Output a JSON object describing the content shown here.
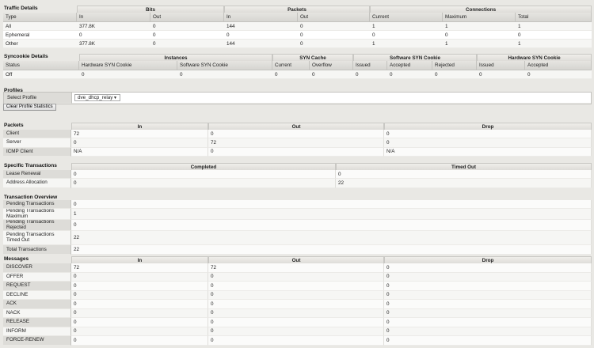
{
  "traffic": {
    "title": "Traffic Details",
    "groups": [
      "Bits",
      "Packets",
      "Connections"
    ],
    "columns": [
      "Type",
      "In",
      "Out",
      "In",
      "Out",
      "Current",
      "Maximum",
      "Total"
    ],
    "rows": [
      [
        "All",
        "377.8K",
        "0",
        "144",
        "0",
        "1",
        "1",
        "1"
      ],
      [
        "Ephemeral",
        "0",
        "0",
        "0",
        "0",
        "0",
        "0",
        "0"
      ],
      [
        "Other",
        "377.8K",
        "0",
        "144",
        "0",
        "1",
        "1",
        "1"
      ]
    ]
  },
  "syncookie": {
    "title": "Syncookie Details",
    "groups": [
      "Instances",
      "SYN Cache",
      "Software SYN Cookie",
      "Hardware SYN Cookie"
    ],
    "columns": [
      "Status",
      "Hardware SYN Cookie",
      "Software SYN Cookie",
      "Current",
      "Overflow",
      "Issued",
      "Accepted",
      "Rejected",
      "Issued",
      "Accepted"
    ],
    "rows": [
      [
        "Off",
        "0",
        "0",
        "0",
        "0",
        "0",
        "0",
        "0",
        "0",
        "0"
      ]
    ]
  },
  "profiles": {
    "title": "Profiles",
    "select_label": "Select Profile",
    "selected": "dve_dhcp_relay",
    "clear_button": "Clear Profile Statistics"
  },
  "packets": {
    "title": "Packets",
    "columns": [
      "In",
      "Out",
      "Drop"
    ],
    "rows": [
      [
        "Client",
        "72",
        "0",
        "0"
      ],
      [
        "Server",
        "0",
        "72",
        "0"
      ],
      [
        "ICMP Client",
        "N/A",
        "0",
        "N/A"
      ]
    ]
  },
  "specific": {
    "title": "Specific Transactions",
    "columns": [
      "Completed",
      "Timed Out"
    ],
    "rows": [
      [
        "Lease Renewal",
        "0",
        "0"
      ],
      [
        "Address Allocation",
        "0",
        "22"
      ]
    ]
  },
  "overview": {
    "title": "Transaction Overview",
    "rows": [
      [
        "Pending Transactions",
        "0"
      ],
      [
        "Pending Transactions Maximum",
        "1"
      ],
      [
        "Pending Transactions Rejected",
        "0"
      ],
      [
        "Pending Transactions Timed Out",
        "22"
      ],
      [
        "Total Transactions",
        "22"
      ]
    ]
  },
  "messages": {
    "title": "Messages",
    "columns": [
      "In",
      "Out",
      "Drop"
    ],
    "rows": [
      [
        "DISCOVER",
        "72",
        "72",
        "0"
      ],
      [
        "OFFER",
        "0",
        "0",
        "0"
      ],
      [
        "REQUEST",
        "0",
        "0",
        "0"
      ],
      [
        "DECLINE",
        "0",
        "0",
        "0"
      ],
      [
        "ACK",
        "0",
        "0",
        "0"
      ],
      [
        "NACK",
        "0",
        "0",
        "0"
      ],
      [
        "RELEASE",
        "0",
        "0",
        "0"
      ],
      [
        "INFORM",
        "0",
        "0",
        "0"
      ],
      [
        "FORCE-RENEW",
        "0",
        "0",
        "0"
      ]
    ]
  }
}
